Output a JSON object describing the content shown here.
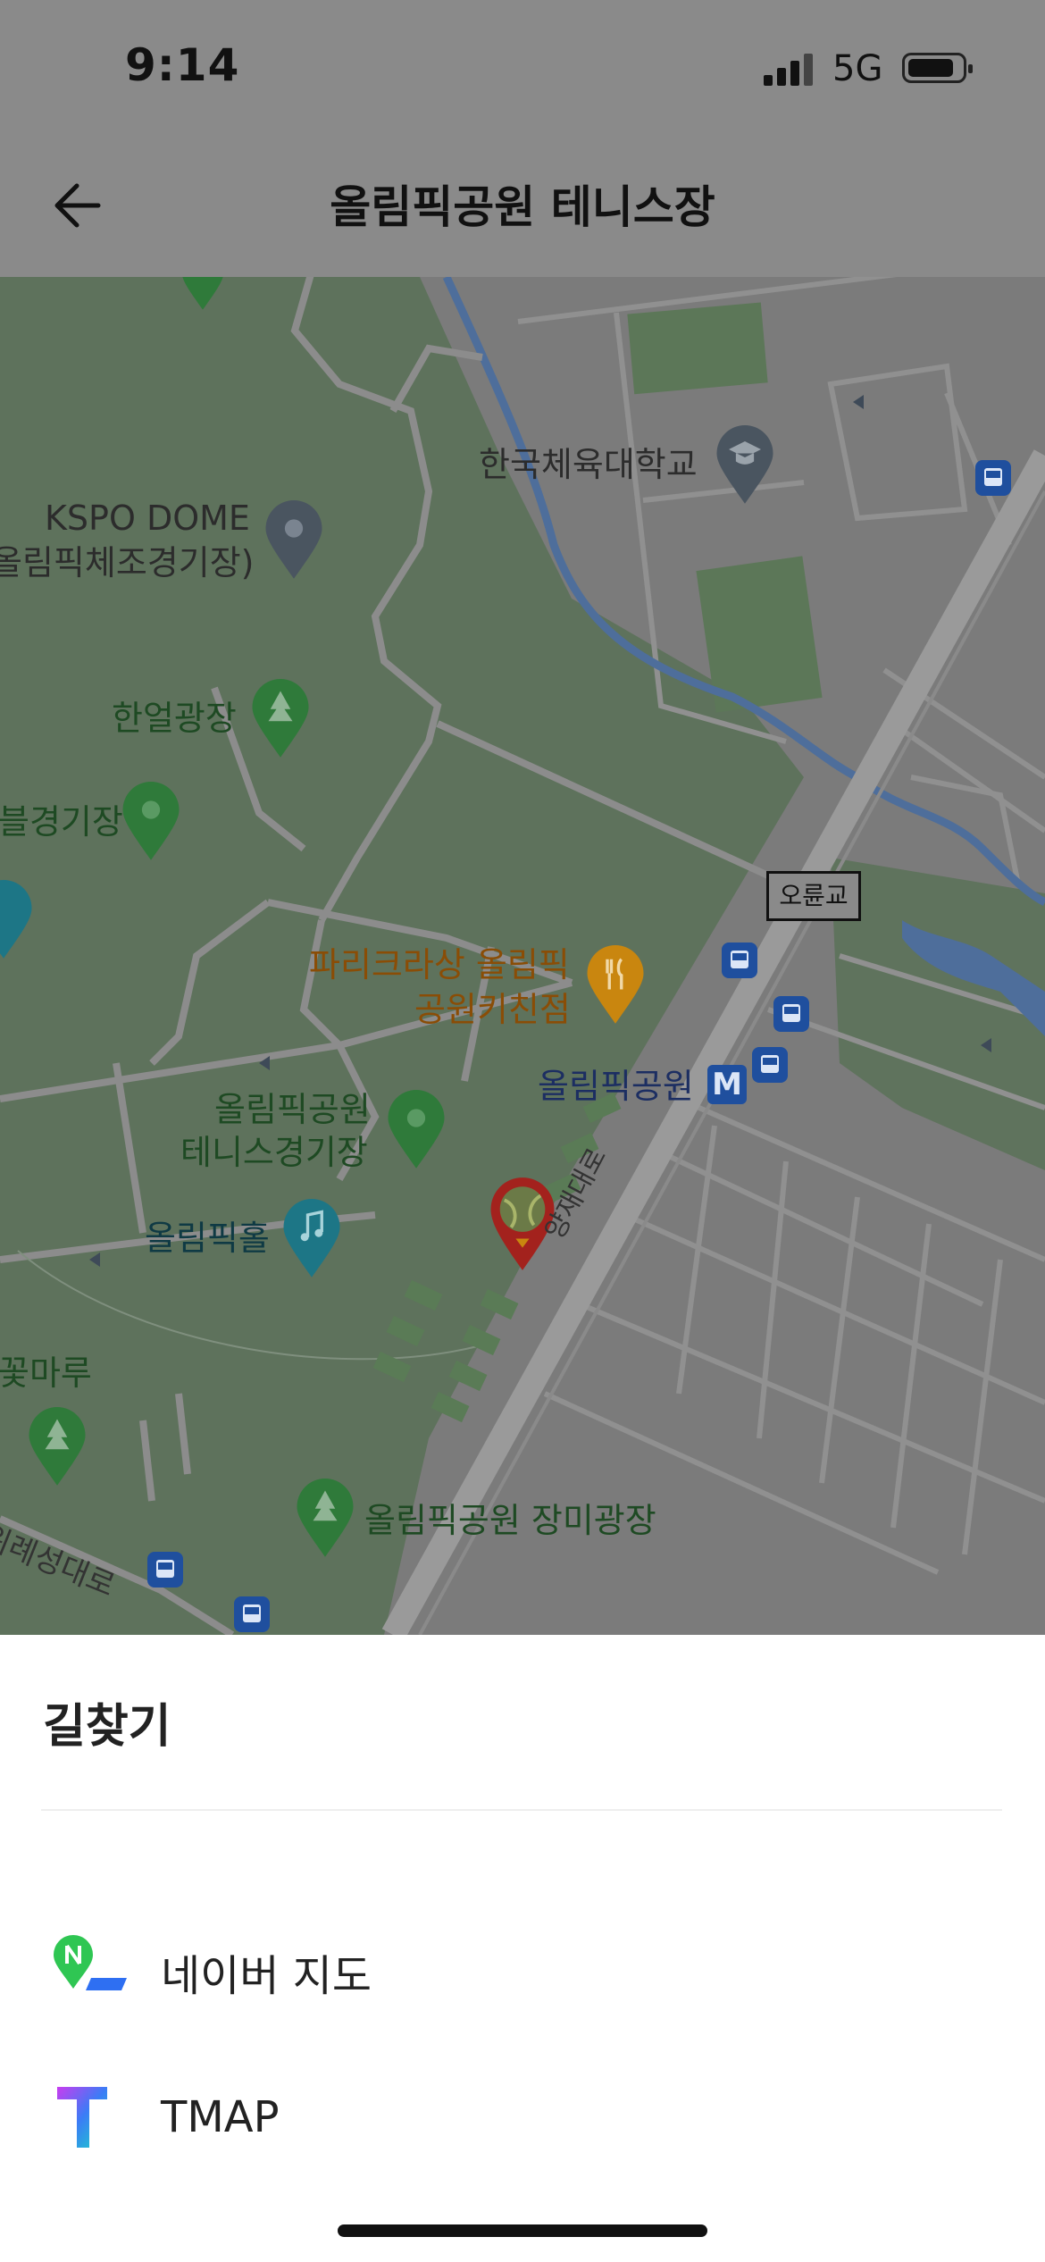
{
  "status_bar": {
    "time": "9:14",
    "network": "5G"
  },
  "header": {
    "title": "올림픽공원 테니스장"
  },
  "map": {
    "labels": {
      "university": "한국체육대학교",
      "kspo_line1": "KSPO DOME",
      "kspo_line2": "올림픽체조경기장)",
      "hanul": "한얼광장",
      "cycling": "블경기장",
      "bridge": "오륜교",
      "paris_line1": "파리크라상 올림픽",
      "paris_line2": "공원키친점",
      "station": "올림픽공원",
      "tennis_line1": "올림픽공원",
      "tennis_line2": "테니스경기장",
      "olympic_hall": "올림픽홀",
      "road": "양재대로",
      "flower": "꽃마루",
      "rose": "올림픽공원 장미광장",
      "wire_road": "위례성대로",
      "metro_badge": "M"
    },
    "colors": {
      "park": "#5e725c",
      "city": "#7b7b7b",
      "road": "#9a9a9a",
      "river": "#4e6e9b",
      "pin_green": "#2f7a3a",
      "pin_orange": "#c9860f",
      "pin_gray": "#4a5560",
      "pin_teal": "#1d7686",
      "pin_red": "#a3221d",
      "bus_blue": "#1f4f9e"
    }
  },
  "sheet": {
    "title": "길찾기",
    "options": [
      {
        "label": "네이버 지도",
        "icon": "naver-map-icon"
      },
      {
        "label": "TMAP",
        "icon": "tmap-icon"
      }
    ]
  }
}
